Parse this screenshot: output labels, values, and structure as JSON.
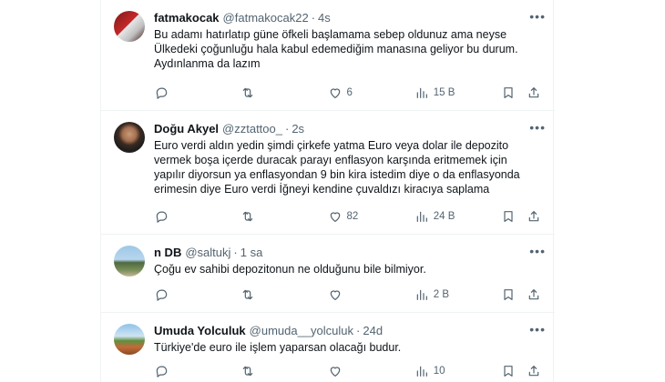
{
  "tweets": [
    {
      "name": "fatmakocak",
      "handle": "@fatmakocak22",
      "time": "4s",
      "lines": [
        "Bu adamı hatırlatıp güne öfkeli başlamama sebep oldunuz ama neyse",
        "Ülkedeki çoğunluğu hala kabul edemediğim manasına geliyor bu durum.",
        "Aydınlanma da lazım"
      ],
      "replies": "",
      "retweets": "",
      "likes": "6",
      "views": "15 B"
    },
    {
      "name": "Doğu Akyel",
      "handle": "@zztattoo_",
      "time": "2s",
      "lines": [
        "Euro verdi aldın yedin şimdi çirkefe yatma Euro veya dolar ile depozito",
        "vermek boşa içerde duracak parayı enflasyon karşında eritmemek için",
        "yapılır diyorsun ya enflasyondan 9 bin kira istedim diye o da enflasyonda",
        "erimesin diye Euro verdi İğneyi kendine çuvaldızı kiracıya saplama"
      ],
      "replies": "",
      "retweets": "",
      "likes": "82",
      "views": "24 B"
    },
    {
      "name": "n DB",
      "handle": "@saltukj",
      "time": "1 sa",
      "lines": [
        "Çoğu ev sahibi depozitonun ne olduğunu bile bilmiyor."
      ],
      "replies": "",
      "retweets": "",
      "likes": "",
      "views": "2 B"
    },
    {
      "name": "Umuda Yolculuk",
      "handle": "@umuda__yolculuk",
      "time": "24d",
      "lines": [
        "Türkiye'de euro ile işlem yaparsan olacağı budur."
      ],
      "replies": "",
      "retweets": "",
      "likes": "",
      "views": "10"
    }
  ],
  "icons": {
    "reply": "reply-icon",
    "retweet": "retweet-icon",
    "like": "like-icon",
    "views": "views-icon",
    "bookmark": "bookmark-icon",
    "share": "share-icon",
    "more": "more-icon"
  },
  "colors": {
    "text": "#0f1419",
    "secondary": "#536471",
    "border": "#eff3f4"
  }
}
